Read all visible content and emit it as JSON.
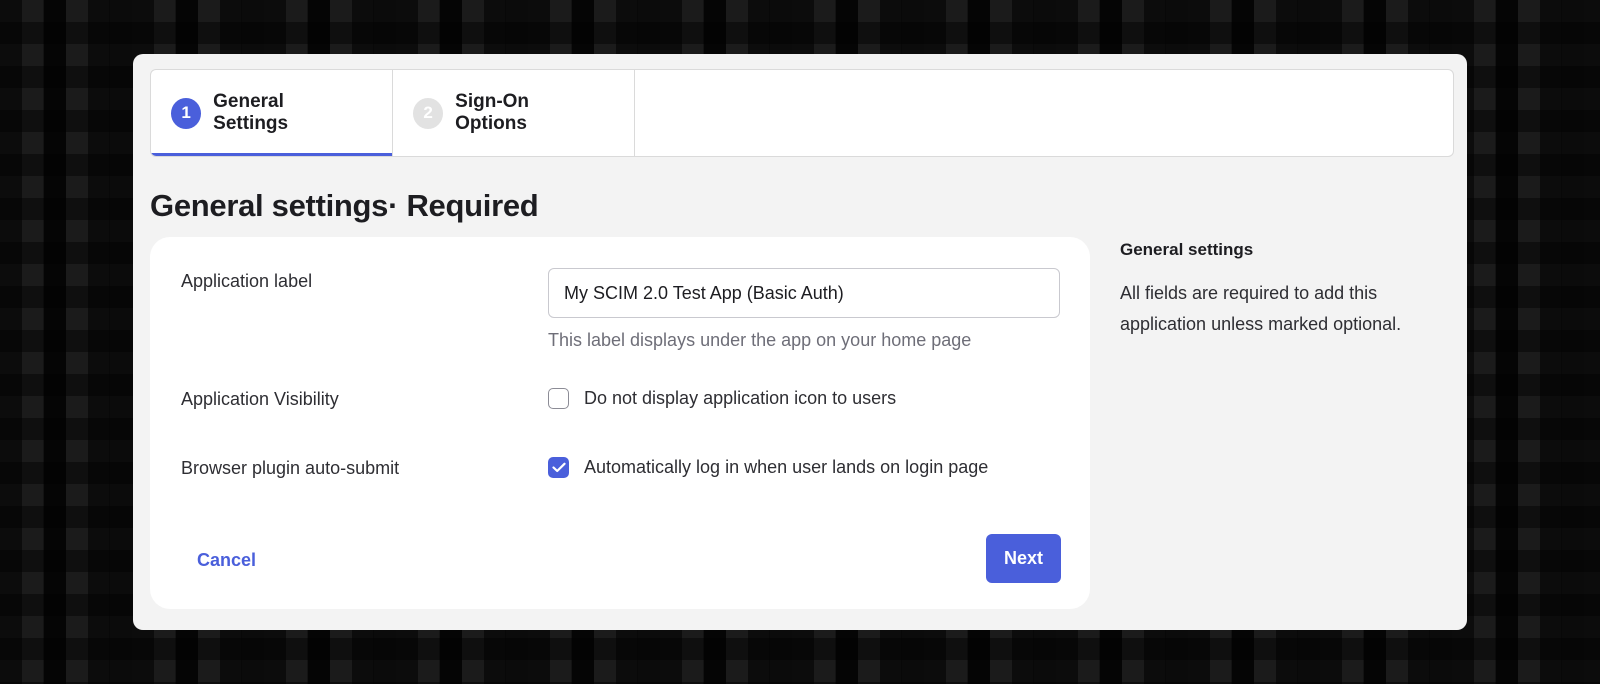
{
  "tabs": [
    {
      "number": "1",
      "label": "General Settings",
      "active": true
    },
    {
      "number": "2",
      "label": "Sign-On Options",
      "active": false
    }
  ],
  "page": {
    "title": "General settings· Required"
  },
  "form": {
    "app_label": {
      "label": "Application label",
      "value": "My SCIM 2.0 Test App (Basic Auth)",
      "hint": "This label displays under the app on your home page"
    },
    "visibility": {
      "label": "Application Visibility",
      "checkbox_label": "Do not display application icon to users",
      "checked": false
    },
    "auto_submit": {
      "label": "Browser plugin auto-submit",
      "checkbox_label": "Automatically log in when user lands on login page",
      "checked": true
    }
  },
  "actions": {
    "cancel": "Cancel",
    "next": "Next"
  },
  "sidebar": {
    "title": "General settings",
    "text": "All fields are required to add this application unless marked optional."
  },
  "colors": {
    "accent": "#4a5fdb",
    "card": "#ffffff",
    "dialog": "#f3f3f3"
  }
}
